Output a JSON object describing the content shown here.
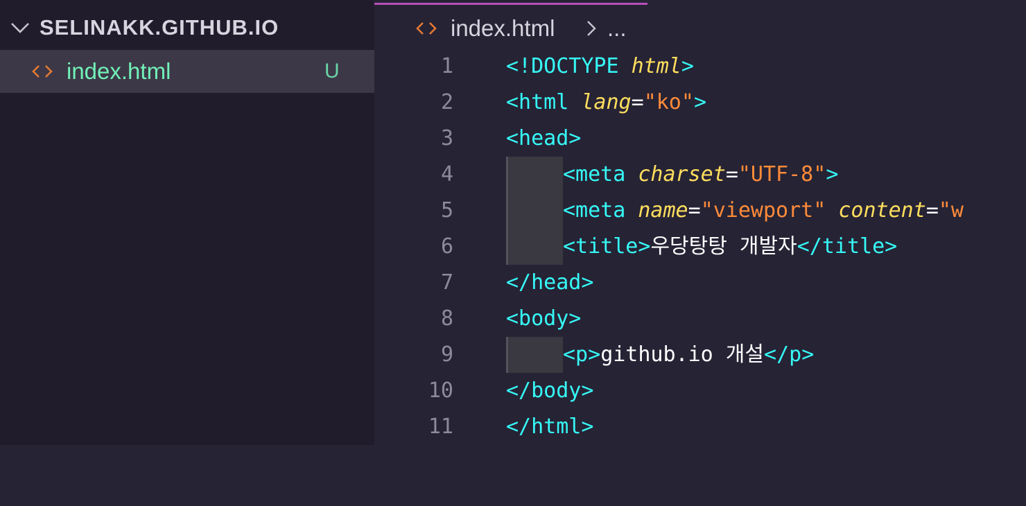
{
  "explorer": {
    "folder_title": "SELINAKK.GITHUB.IO",
    "files": [
      {
        "name": "index.html",
        "badge": "U"
      }
    ]
  },
  "editor": {
    "breadcrumb": {
      "file": "index.html",
      "more": "..."
    },
    "lines": [
      {
        "number": "1",
        "tokens": [
          "<!DOCTYPE ",
          "html",
          ">"
        ]
      },
      {
        "number": "2",
        "tokens": [
          "<html ",
          "lang",
          "=",
          "\"ko\"",
          ">"
        ]
      },
      {
        "number": "3",
        "tokens": [
          "<head>"
        ]
      },
      {
        "number": "4",
        "tokens": [
          "<meta ",
          "charset",
          "=",
          "\"UTF-8\"",
          ">"
        ]
      },
      {
        "number": "5",
        "tokens": [
          "<meta ",
          "name",
          "=",
          "\"viewport\"",
          " ",
          "content",
          "=",
          "\"w"
        ]
      },
      {
        "number": "6",
        "tokens": [
          "<title>",
          "우당탕탕 개발자",
          "</title>"
        ]
      },
      {
        "number": "7",
        "tokens": [
          "</head>"
        ]
      },
      {
        "number": "8",
        "tokens": [
          "<body>"
        ]
      },
      {
        "number": "9",
        "tokens": [
          "<p>",
          "github.io 개설",
          "</p>"
        ]
      },
      {
        "number": "10",
        "tokens": [
          "</body>"
        ]
      },
      {
        "number": "11",
        "tokens": [
          "</html>"
        ]
      }
    ]
  },
  "colors": {
    "sidebar_bg": "#211c2c",
    "editor_bg": "#262335",
    "selected_row": "#3c3847",
    "tab_accent": "#b64fb8",
    "git_untracked": "#72f1b8",
    "tag": "#36f9f6",
    "attribute": "#fede5d",
    "string": "#ff8b39",
    "html_icon": "#e37933"
  },
  "icons": {
    "folder_toggle": "chevron-down-icon",
    "file_type": "html-brackets-icon",
    "breadcrumb_separator": "chevron-right-icon"
  }
}
